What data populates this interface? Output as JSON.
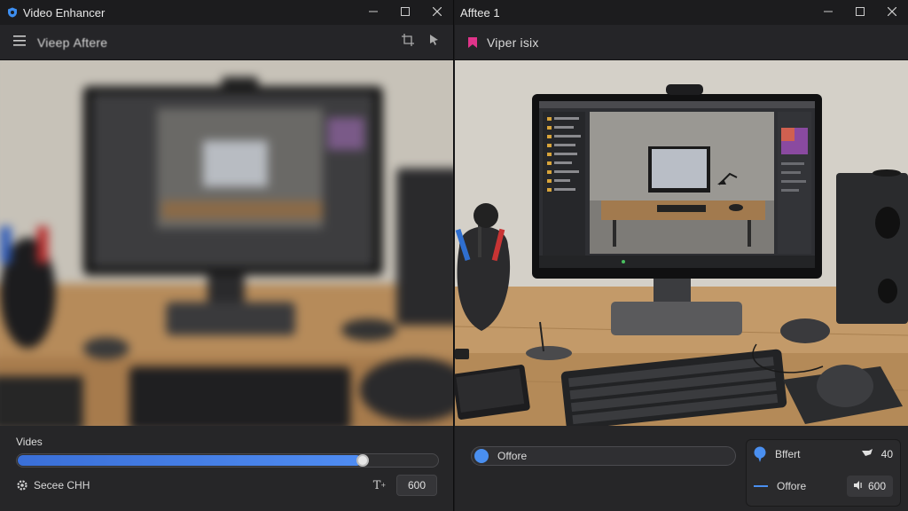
{
  "left_window": {
    "title": "Video Enhancer",
    "toolbar_title": "Viеер Aftere",
    "slider_label": "Vides",
    "slider_value": 0.82,
    "settings_label": "Secee CHH",
    "value": "600",
    "accent": "#4f8cf2"
  },
  "right_window": {
    "title": "Afftee 1",
    "toolbar_title": "Viper isix",
    "field_text": "Offore",
    "panel": {
      "row1_label": "Bffert",
      "row1_value": "40",
      "row2_label": "Offore",
      "row2_value": "600"
    },
    "accent": "#4a8ff0",
    "badge_color": "#e0348a"
  },
  "icons": {
    "app": "shield-icon",
    "minimize": "minimize-icon",
    "maximize": "maximize-icon",
    "close": "close-icon",
    "menu": "hamburger-menu-icon",
    "crop": "crop-icon",
    "pointer": "pointer-icon",
    "settings": "gear-icon",
    "text": "text-size-icon",
    "pin": "pin-icon",
    "volume": "volume-icon"
  }
}
